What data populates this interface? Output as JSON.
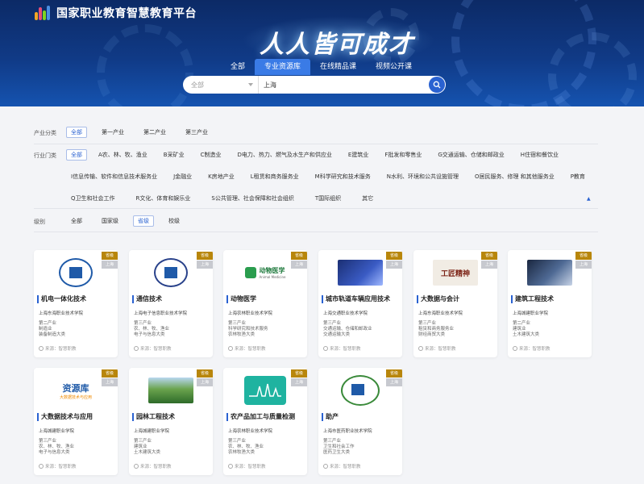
{
  "header": {
    "site_title": "国家职业教育智慧教育平台",
    "slogan": "人人皆可成才",
    "tabs": [
      {
        "label": "全部"
      },
      {
        "label": "专业资源库"
      },
      {
        "label": "在线精品课"
      },
      {
        "label": "视频公开课"
      }
    ],
    "active_tab": 1,
    "search": {
      "select_value": "全部",
      "query": "上海"
    }
  },
  "filters": {
    "industry_category": {
      "label": "产业分类",
      "options": [
        "全部",
        "第一产业",
        "第二产业",
        "第三产业"
      ]
    },
    "industry_sector": {
      "label": "行业门类",
      "row1": [
        "全部",
        "A农、林、牧、渔业",
        "B采矿业",
        "C制造业",
        "D电力、热力、燃气及水生产和供应业",
        "E建筑业",
        "F批发和零售业",
        "G交通运输、仓储和邮政业",
        "H住宿和餐饮业"
      ],
      "row2": [
        "I信息传输、软件和信息技术服务业",
        "J金融业",
        "K房地产业",
        "L租赁和商务服务业",
        "M科学研究和技术服务",
        "N水利、环境和公共设施管理",
        "O居民服务、修理 和其他服务业",
        "P教育"
      ],
      "row3": [
        "Q卫生和社会工作",
        "R文化、体育和娱乐业",
        "S公共管理、社会保障和社会组织",
        "T国际组织",
        "其它"
      ]
    },
    "level": {
      "label": "级别",
      "options": [
        "全部",
        "国家级",
        "省级",
        "校级"
      ]
    }
  },
  "cards": [
    {
      "title": "机电一体化技术",
      "level": "省级",
      "city": "上海",
      "school": "上海东海职业技术学院",
      "info": [
        "第二产业",
        "制造业",
        "装备制造大类"
      ],
      "source": "来源：智慧职教",
      "thumb": "school-emblem"
    },
    {
      "title": "通信技术",
      "level": "省级",
      "city": "上海",
      "school": "上海电子信息职业技术学院",
      "info": [
        "第三产业",
        "农、林、牧、渔业",
        "电子与信息大类"
      ],
      "source": "来源：智慧职教",
      "thumb": "school-emblem"
    },
    {
      "title": "动物医学",
      "level": "省级",
      "city": "上海",
      "school": "上海农林职业技术学院",
      "info": [
        "第三产业",
        "科学研究和技术服务",
        "农林牧渔大类"
      ],
      "source": "来源：智慧职教",
      "thumb": "animal-medicine-logo",
      "thumb_text": "动物医学",
      "thumb_subtext": "Animal Medicine"
    },
    {
      "title": "城市轨道车辆应用技术",
      "level": "省级",
      "city": "上海",
      "school": "上海交通职业技术学院",
      "info": [
        "第三产业",
        "交通运输、仓储和邮政业",
        "交通运输大类"
      ],
      "source": "来源：智慧职教",
      "thumb": "rail-photo"
    },
    {
      "title": "大数据与会计",
      "level": "省级",
      "city": "上海",
      "school": "上海东海职业技术学院",
      "info": [
        "第三产业",
        "租赁和商务服务业",
        "财经商贸大类"
      ],
      "source": "来源：智慧职教",
      "thumb": "craftsman-banner",
      "thumb_text": "工匠精神"
    },
    {
      "title": "建筑工程技术",
      "level": "省级",
      "city": "上海",
      "school": "上海城建职业学院",
      "info": [
        "第二产业",
        "建筑业",
        "土木建筑大类"
      ],
      "source": "来源：智慧职教",
      "thumb": "construction-photo"
    },
    {
      "title": "大数据技术与应用",
      "level": "省级",
      "city": "上海",
      "school": "上海城建职业学院",
      "info": [
        "第三产业",
        "农、林、牧、渔业",
        "电子与信息大类"
      ],
      "source": "来源：智慧职教",
      "thumb": "zhiyuanku-logo",
      "thumb_text": "资源库",
      "thumb_subtext": "大数据技术与应用"
    },
    {
      "title": "园林工程技术",
      "level": "省级",
      "city": "上海",
      "school": "上海城建职业学院",
      "info": [
        "第三产业",
        "建筑业",
        "土木建筑大类"
      ],
      "source": "来源：智慧职教",
      "thumb": "garden-photo"
    },
    {
      "title": "农产品加工与质量检测",
      "level": "省级",
      "city": "上海",
      "school": "上海农林职业技术学院",
      "info": [
        "第三产业",
        "农、林、牧、渔业",
        "农林牧渔大类"
      ],
      "source": "来源：智慧职教",
      "thumb": "chart-icon"
    },
    {
      "title": "助产",
      "level": "省级",
      "city": "上海",
      "school": "上海市医药职业技术学院",
      "info": [
        "第三产业",
        "卫生和社会工作",
        "医药卫生大类"
      ],
      "source": "来源：智慧职教",
      "thumb": "school-seal"
    }
  ],
  "colors": {
    "primary": "#2a62d1",
    "level_badge": "#b8860b",
    "hero_dark": "#0c2a66"
  }
}
